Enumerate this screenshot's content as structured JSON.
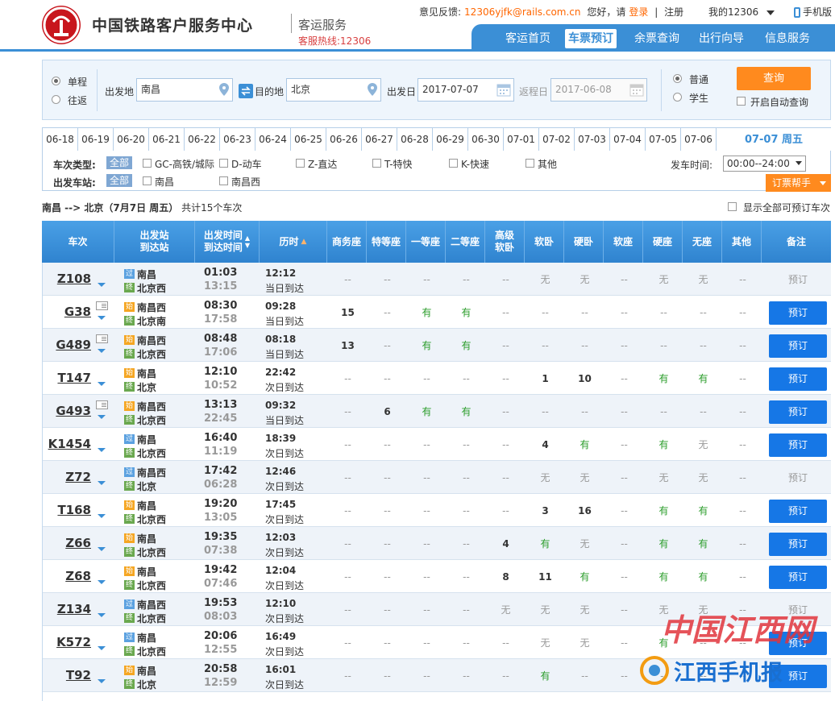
{
  "header": {
    "brand": "中国铁路客户服务中心",
    "subtitle": "客运服务",
    "hotline": "客服热线:12306",
    "feedback_label": "意见反馈:",
    "feedback_email": "12306yjfk@rails.com.cn",
    "greeting": "您好，请",
    "login": "登录",
    "divider": "|",
    "register": "注册",
    "my12306": "我的12306",
    "mobile": "手机版"
  },
  "nav": {
    "items": [
      "客运首页",
      "车票预订",
      "余票查询",
      "出行向导",
      "信息服务"
    ],
    "active": 1
  },
  "query": {
    "single": "单程",
    "round": "往返",
    "from_label": "出发地",
    "from_value": "南昌",
    "to_label": "目的地",
    "to_value": "北京",
    "depart_label": "出发日",
    "depart_value": "2017-07-07",
    "return_label": "返程日",
    "return_value": "2017-06-08",
    "normal": "普通",
    "student": "学生",
    "search": "查询",
    "auto": "开启自动查询"
  },
  "dates": {
    "items": [
      "06-18",
      "06-19",
      "06-20",
      "06-21",
      "06-22",
      "06-23",
      "06-24",
      "06-25",
      "06-26",
      "06-27",
      "06-28",
      "06-29",
      "06-30",
      "07-01",
      "07-02",
      "07-03",
      "07-04",
      "07-05",
      "07-06"
    ],
    "active": "07-07 周五"
  },
  "filter": {
    "type_label": "车次类型:",
    "all": "全部",
    "types": [
      "GC-高铁/城际",
      "D-动车",
      "Z-直达",
      "T-特快",
      "K-快速",
      "其他"
    ],
    "station_label": "出发车站:",
    "stations": [
      "南昌",
      "南昌西"
    ],
    "time_label": "发车时间:",
    "time_value": "00:00--24:00",
    "help": "订票帮手"
  },
  "summary": {
    "route": "南昌 --> 北京（7月7日  周五）",
    "count": "共计15个车次",
    "show_all": "显示全部可预订车次"
  },
  "table": {
    "headers": [
      "车次",
      "出发站\n到达站",
      "出发时间\n到达时间",
      "历时",
      "商务座",
      "特等座",
      "一等座",
      "二等座",
      "高级\n软卧",
      "软卧",
      "硬卧",
      "软座",
      "硬座",
      "无座",
      "其他",
      "备注"
    ],
    "book_label": "预订",
    "rows": [
      {
        "no": "Z108",
        "card": false,
        "fb": "过",
        "fs": "南昌",
        "tb": "终",
        "ts": "北京西",
        "dep": "01:03",
        "arr": "13:15",
        "dur": "12:12",
        "day": "当日到达",
        "seats": [
          "--",
          "--",
          "--",
          "--",
          "--",
          "无",
          "无",
          "--",
          "无",
          "无",
          "--"
        ],
        "book": false
      },
      {
        "no": "G38",
        "card": true,
        "fb": "始",
        "fs": "南昌西",
        "tb": "终",
        "ts": "北京南",
        "dep": "08:30",
        "arr": "17:58",
        "dur": "09:28",
        "day": "当日到达",
        "seats": [
          "15",
          "--",
          "有",
          "有",
          "--",
          "--",
          "--",
          "--",
          "--",
          "--",
          "--"
        ],
        "book": true
      },
      {
        "no": "G489",
        "card": true,
        "fb": "始",
        "fs": "南昌西",
        "tb": "终",
        "ts": "北京西",
        "dep": "08:48",
        "arr": "17:06",
        "dur": "08:18",
        "day": "当日到达",
        "seats": [
          "13",
          "--",
          "有",
          "有",
          "--",
          "--",
          "--",
          "--",
          "--",
          "--",
          "--"
        ],
        "book": true
      },
      {
        "no": "T147",
        "card": false,
        "fb": "始",
        "fs": "南昌",
        "tb": "终",
        "ts": "北京",
        "dep": "12:10",
        "arr": "10:52",
        "dur": "22:42",
        "day": "次日到达",
        "seats": [
          "--",
          "--",
          "--",
          "--",
          "--",
          "1",
          "10",
          "--",
          "有",
          "有",
          "--"
        ],
        "book": true
      },
      {
        "no": "G493",
        "card": true,
        "fb": "始",
        "fs": "南昌西",
        "tb": "终",
        "ts": "北京西",
        "dep": "13:13",
        "arr": "22:45",
        "dur": "09:32",
        "day": "当日到达",
        "seats": [
          "--",
          "6",
          "有",
          "有",
          "--",
          "--",
          "--",
          "--",
          "--",
          "--",
          "--"
        ],
        "book": true
      },
      {
        "no": "K1454",
        "card": false,
        "fb": "过",
        "fs": "南昌",
        "tb": "终",
        "ts": "北京西",
        "dep": "16:40",
        "arr": "11:19",
        "dur": "18:39",
        "day": "次日到达",
        "seats": [
          "--",
          "--",
          "--",
          "--",
          "--",
          "4",
          "有",
          "--",
          "有",
          "无",
          "--"
        ],
        "book": true
      },
      {
        "no": "Z72",
        "card": false,
        "fb": "过",
        "fs": "南昌西",
        "tb": "终",
        "ts": "北京",
        "dep": "17:42",
        "arr": "06:28",
        "dur": "12:46",
        "day": "次日到达",
        "seats": [
          "--",
          "--",
          "--",
          "--",
          "--",
          "无",
          "无",
          "--",
          "无",
          "无",
          "--"
        ],
        "book": false
      },
      {
        "no": "T168",
        "card": false,
        "fb": "始",
        "fs": "南昌",
        "tb": "终",
        "ts": "北京西",
        "dep": "19:20",
        "arr": "13:05",
        "dur": "17:45",
        "day": "次日到达",
        "seats": [
          "--",
          "--",
          "--",
          "--",
          "--",
          "3",
          "16",
          "--",
          "有",
          "有",
          "--"
        ],
        "book": true
      },
      {
        "no": "Z66",
        "card": false,
        "fb": "始",
        "fs": "南昌",
        "tb": "终",
        "ts": "北京西",
        "dep": "19:35",
        "arr": "07:38",
        "dur": "12:03",
        "day": "次日到达",
        "seats": [
          "--",
          "--",
          "--",
          "--",
          "4",
          "有",
          "无",
          "--",
          "有",
          "有",
          "--"
        ],
        "book": true
      },
      {
        "no": "Z68",
        "card": false,
        "fb": "始",
        "fs": "南昌",
        "tb": "终",
        "ts": "北京西",
        "dep": "19:42",
        "arr": "07:46",
        "dur": "12:04",
        "day": "次日到达",
        "seats": [
          "--",
          "--",
          "--",
          "--",
          "8",
          "11",
          "有",
          "--",
          "有",
          "有",
          "--"
        ],
        "book": true
      },
      {
        "no": "Z134",
        "card": false,
        "fb": "过",
        "fs": "南昌西",
        "tb": "终",
        "ts": "北京西",
        "dep": "19:53",
        "arr": "08:03",
        "dur": "12:10",
        "day": "次日到达",
        "seats": [
          "--",
          "--",
          "--",
          "--",
          "无",
          "无",
          "无",
          "--",
          "无",
          "无",
          "--"
        ],
        "book": false
      },
      {
        "no": "K572",
        "card": false,
        "fb": "过",
        "fs": "南昌",
        "tb": "终",
        "ts": "北京西",
        "dep": "20:06",
        "arr": "12:55",
        "dur": "16:49",
        "day": "次日到达",
        "seats": [
          "--",
          "--",
          "--",
          "--",
          "--",
          "无",
          "无",
          "--",
          "有",
          "--",
          "--"
        ],
        "book": true
      },
      {
        "no": "T92",
        "card": false,
        "fb": "始",
        "fs": "南昌",
        "tb": "终",
        "ts": "北京",
        "dep": "20:58",
        "arr": "12:59",
        "dur": "16:01",
        "day": "次日到达",
        "seats": [
          "--",
          "--",
          "--",
          "--",
          "--",
          "有",
          "--",
          "--",
          "--",
          "--",
          "--"
        ],
        "book": true
      }
    ]
  },
  "watermark": {
    "line1": "中国江西网",
    "line2": "江西手机报"
  },
  "colors": {
    "primary": "#3b8fd6",
    "orange": "#ff8a1e",
    "book": "#1677e6",
    "green": "#2a9c2a",
    "red": "#c8161d"
  }
}
